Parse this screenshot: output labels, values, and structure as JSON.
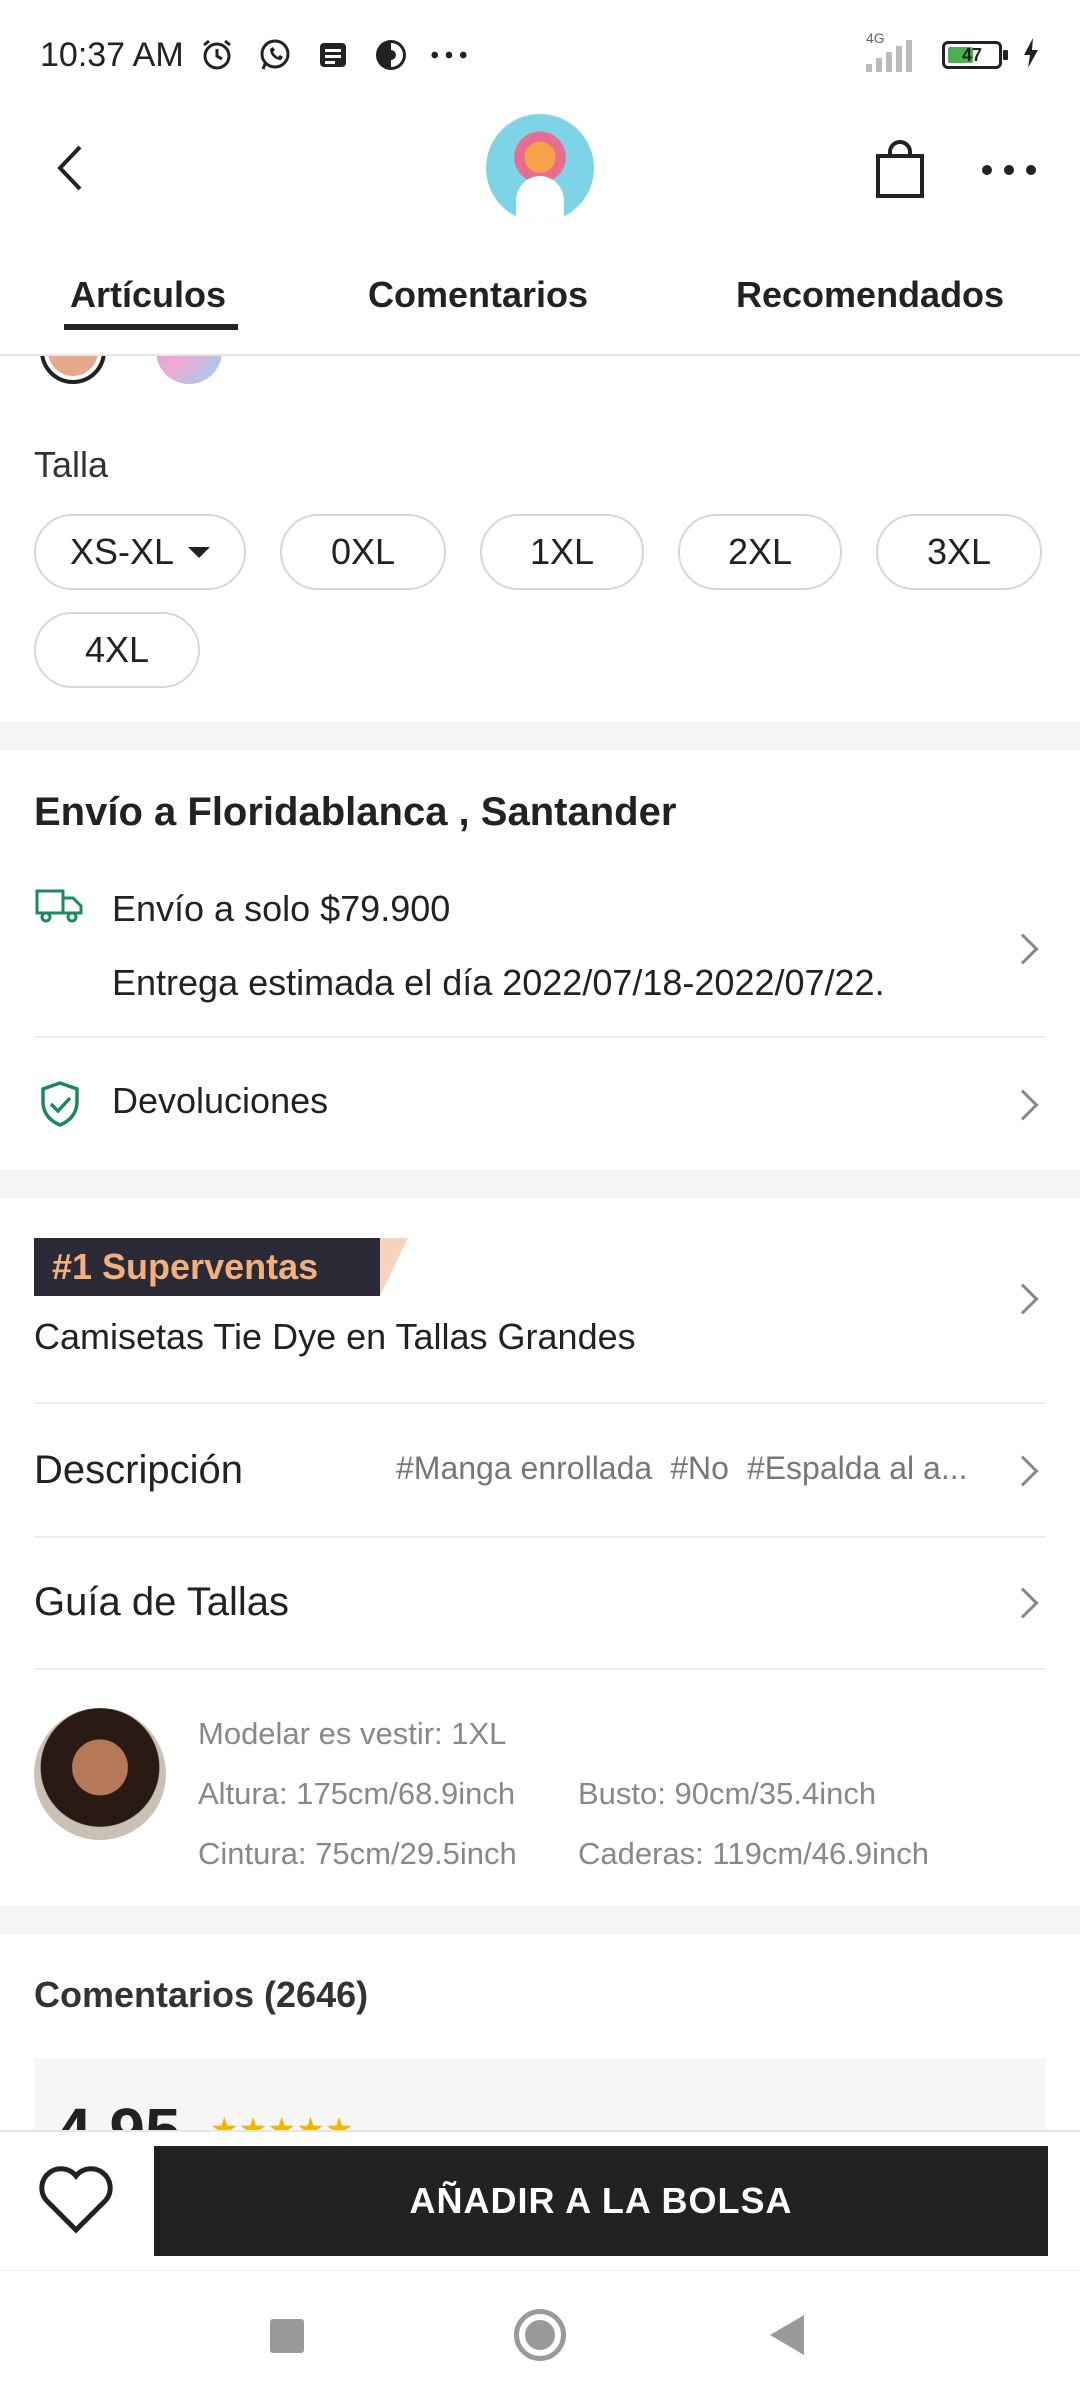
{
  "status_bar": {
    "time": "10:37 AM",
    "network": "4G",
    "battery": "47",
    "icons": [
      "alarm-icon",
      "whatsapp-icon",
      "message-icon",
      "app-icon",
      "more-dots-icon",
      "signal-icon",
      "battery-icon",
      "charging-icon"
    ]
  },
  "header": {
    "icons": [
      "back-icon",
      "shopping-bag-icon",
      "more-icon"
    ]
  },
  "tabs": [
    {
      "label": "Artículos",
      "active": true
    },
    {
      "label": "Comentarios",
      "active": false
    },
    {
      "label": "Recomendados",
      "active": false
    }
  ],
  "size": {
    "label": "Talla",
    "options": [
      "XS-XL",
      "0XL",
      "1XL",
      "2XL",
      "3XL",
      "4XL"
    ]
  },
  "shipping": {
    "title": "Envío a Floridablanca , Santander",
    "cost": "Envío a solo $79.900",
    "estimate": "Entrega estimada el día 2022/07/18-2022/07/22.",
    "returns": "Devoluciones",
    "accent": "#1a8a5c"
  },
  "bestseller": {
    "badge": "#1 Superventas",
    "category": "Camisetas Tie Dye en Tallas Grandes"
  },
  "description": {
    "label": "Descripción",
    "tags": [
      "#Manga enrollada",
      "#No",
      "#Espalda al a..."
    ]
  },
  "size_guide": {
    "label": "Guía de Tallas"
  },
  "model": {
    "wearing": "Modelar es vestir: 1XL",
    "height": "Altura: 175cm/68.9inch",
    "bust": "Busto: 90cm/35.4inch",
    "waist": "Cintura: 75cm/29.5inch",
    "hips": "Caderas: 119cm/46.9inch"
  },
  "comments": {
    "title": "Comentarios (2646)",
    "rating": "4.95",
    "stars": "★★★★★"
  },
  "actions": {
    "add_to_bag": "AÑADIR A LA BOLSA"
  }
}
